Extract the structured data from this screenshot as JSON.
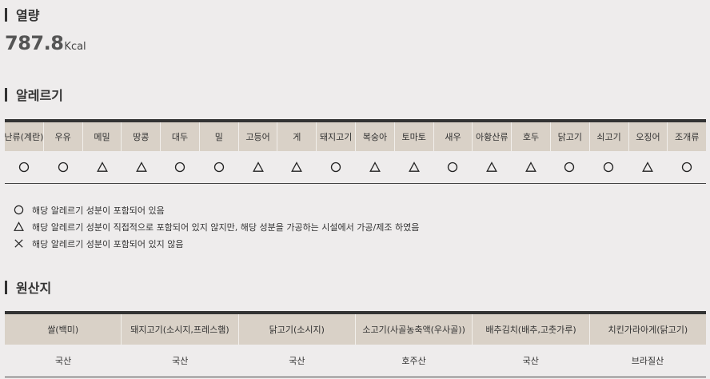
{
  "calorie": {
    "title": "열량",
    "value": "787.8",
    "unit": "Kcal"
  },
  "allergy": {
    "title": "알레르기",
    "items": [
      {
        "name": "난류(계란)",
        "mark": "circle"
      },
      {
        "name": "우유",
        "mark": "circle"
      },
      {
        "name": "메밀",
        "mark": "triangle"
      },
      {
        "name": "땅콩",
        "mark": "triangle"
      },
      {
        "name": "대두",
        "mark": "circle"
      },
      {
        "name": "밀",
        "mark": "circle"
      },
      {
        "name": "고등어",
        "mark": "triangle"
      },
      {
        "name": "게",
        "mark": "triangle"
      },
      {
        "name": "돼지고기",
        "mark": "circle"
      },
      {
        "name": "복숭아",
        "mark": "triangle"
      },
      {
        "name": "토마토",
        "mark": "triangle"
      },
      {
        "name": "새우",
        "mark": "circle"
      },
      {
        "name": "아황산류",
        "mark": "triangle"
      },
      {
        "name": "호두",
        "mark": "triangle"
      },
      {
        "name": "닭고기",
        "mark": "circle"
      },
      {
        "name": "쇠고기",
        "mark": "circle"
      },
      {
        "name": "오징어",
        "mark": "triangle"
      },
      {
        "name": "조개류",
        "mark": "circle"
      }
    ],
    "legend": [
      {
        "mark": "circle",
        "text": "해당 알레르기 성분이 포함되어 있음"
      },
      {
        "mark": "triangle",
        "text": "해당 알레르기 성분이 직접적으로 포함되어 있지 않지만, 해당 성분을 가공하는 시설에서 가공/제조 하였음"
      },
      {
        "mark": "cross",
        "text": "해당 알레르기 성분이 포함되어 있지 않음"
      }
    ]
  },
  "origin": {
    "title": "원산지",
    "items": [
      {
        "name": "쌀(백미)",
        "origin": "국산"
      },
      {
        "name": "돼지고기(소시지,프레스햄)",
        "origin": "국산"
      },
      {
        "name": "닭고기(소시지)",
        "origin": "국산"
      },
      {
        "name": "소고기(사골농축액(우사골))",
        "origin": "호주산"
      },
      {
        "name": "배추김치(배추,고춧가루)",
        "origin": "국산"
      },
      {
        "name": "치킨가라아게(닭고기)",
        "origin": "브라질산"
      }
    ]
  },
  "colors": {
    "header_bg": "#d9d1c7",
    "page_bg": "#eeecec",
    "rule": "#333333"
  }
}
